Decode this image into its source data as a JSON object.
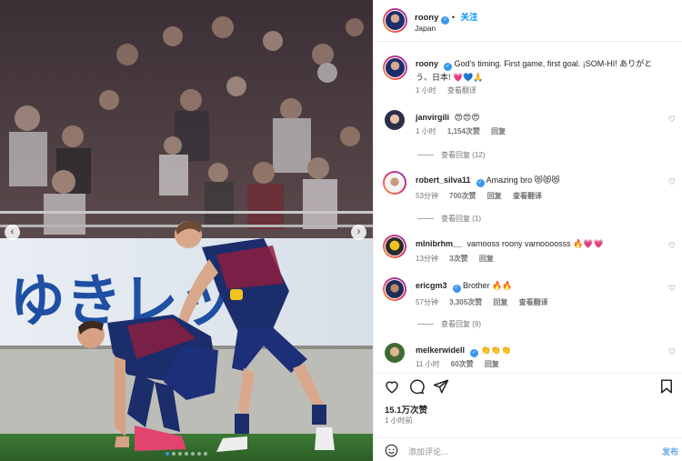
{
  "post": {
    "author": "roony",
    "location": "Japan",
    "follow_label": "关注",
    "likes": "15.1万次赞",
    "posted_ago": "1 小时前",
    "add_comment_placeholder": "添加评论...",
    "post_label": "发布"
  },
  "caption": {
    "username": "roony",
    "text": "God's timing. First game, first goal. ¡SOM-HI! ありがとう、日本! 💗💙🙏",
    "time": "1 小时",
    "translate": "查看翻译"
  },
  "comments": [
    {
      "username": "janvirgili",
      "verified": false,
      "text": "😍😍😍",
      "time": "1 小时",
      "likes": "1,154次赞",
      "reply": "回复",
      "translate": "",
      "replies": "查看回复 (12)"
    },
    {
      "username": "robert_silva11",
      "verified": true,
      "text": "Amazing bro 😻😻😻",
      "time": "53分钟",
      "likes": "700次赞",
      "reply": "回复",
      "translate": "查看翻译",
      "replies": "查看回复 (1)"
    },
    {
      "username": "mlnibrhm__",
      "verified": false,
      "text": "vamooss roony vamoooosss 🔥💗💗",
      "time": "13分钟",
      "likes": "3次赞",
      "reply": "回复",
      "translate": "",
      "replies": ""
    },
    {
      "username": "ericgm3",
      "verified": true,
      "text": "Brother 🔥🔥",
      "time": "57分钟",
      "likes": "3,305次赞",
      "reply": "回复",
      "translate": "查看翻译",
      "replies": "查看回复 (9)"
    },
    {
      "username": "melkerwidell",
      "verified": true,
      "text": "👏👏👏",
      "time": "11 小时",
      "likes": "60次赞",
      "reply": "回复",
      "translate": "",
      "replies": ""
    }
  ],
  "banner_text": "ゆきレッ",
  "colors": {
    "accent": "#0095f6",
    "verified": "#3897f0",
    "heart_red": "#ed4956"
  },
  "carousel": {
    "slides": 7,
    "active_index": 0
  },
  "icons": [
    "heart-icon",
    "comment-icon",
    "share-icon",
    "bookmark-icon",
    "emoji-icon",
    "verified-icon",
    "chevron-left-icon",
    "chevron-right-icon"
  ]
}
